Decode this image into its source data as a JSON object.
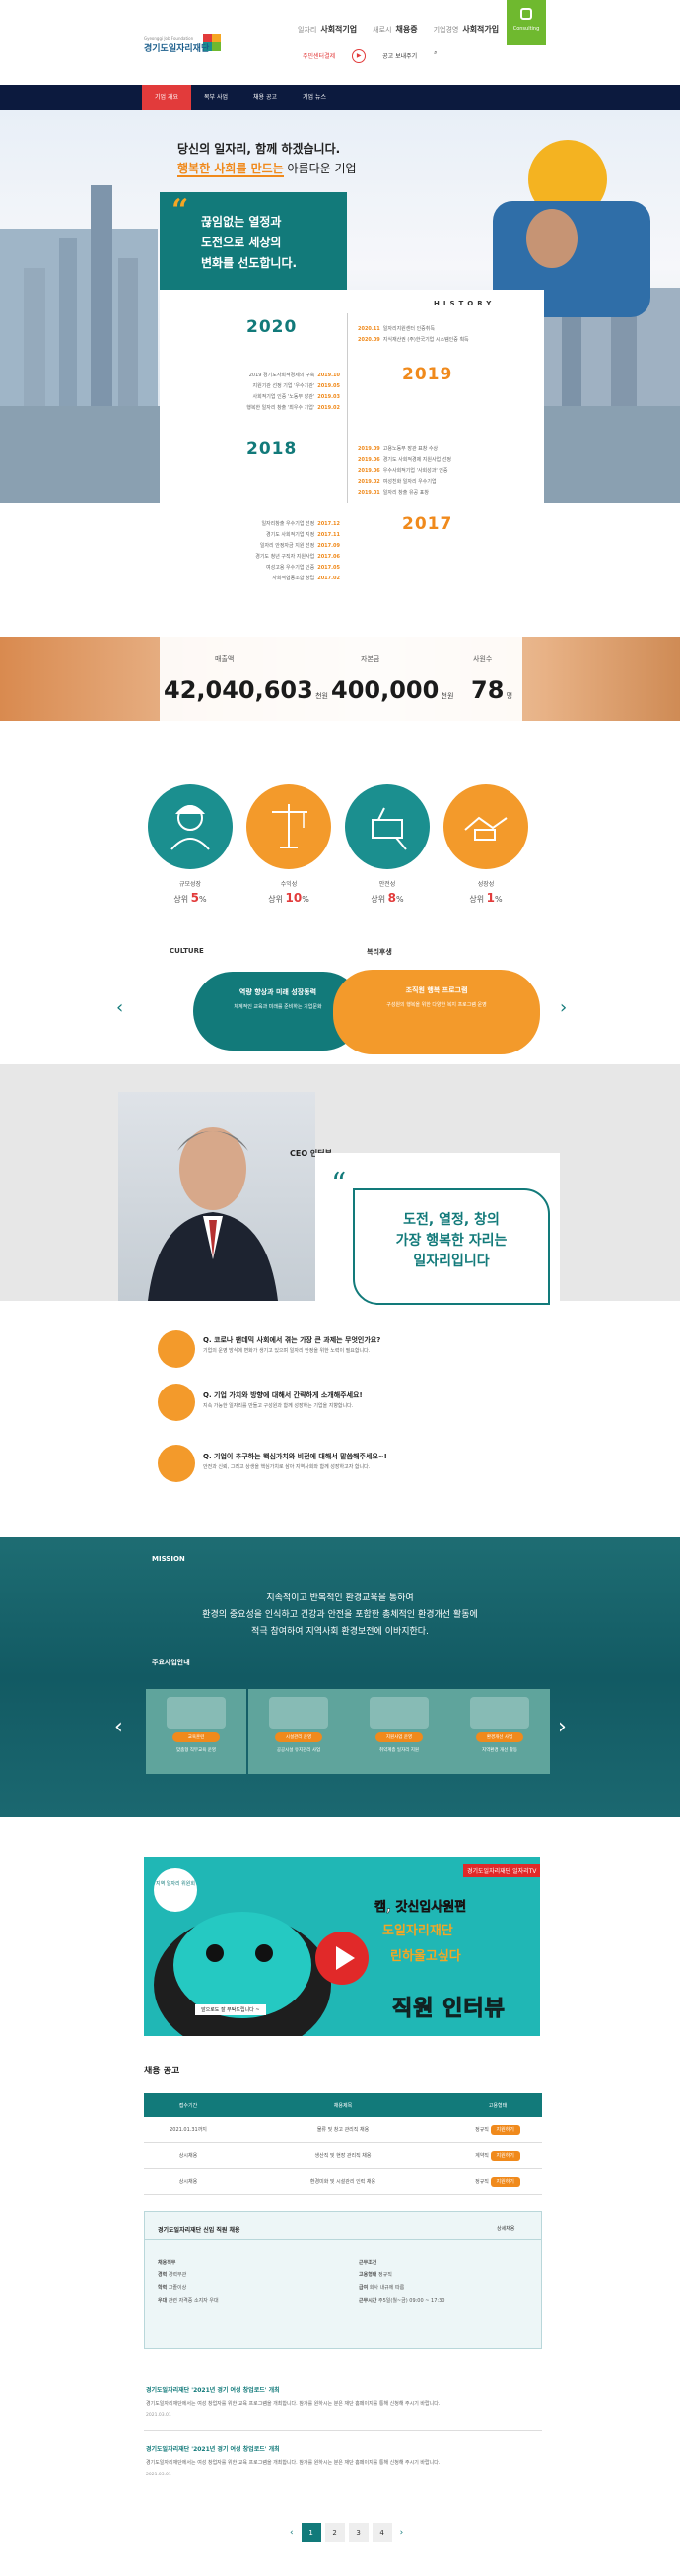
{
  "header": {
    "links": [
      {
        "pre": "일자리",
        "label": "사회적기업"
      },
      {
        "pre": "새로시",
        "label": "채용증"
      },
      {
        "pre": "기업경영",
        "label": "사회적가입"
      }
    ],
    "sub_links": [
      "주민센터결제",
      "공고 보내주기"
    ],
    "consult": "Consulting"
  },
  "nav": {
    "items": [
      "기업 개요",
      "복부 사업",
      "채용 공고",
      "기업 뉴스"
    ]
  },
  "hero": {
    "title1": "당신의 일자리, 함께 하겠습니다.",
    "title2_hl": "행복한 사회를 만드는",
    "title2_rest": " 아름다운 기업",
    "quote_mark": "“",
    "quote_lines": [
      "끊임없는 열정과",
      "도전으로 세상의",
      "변화를 선도합니다."
    ],
    "history_label": "HISTORY"
  },
  "history": {
    "y2020": "2020",
    "y2019": "2019",
    "y2018": "2018",
    "y2017": "2017",
    "right_2020": [
      {
        "d": "2020.11",
        "t": "일자리지원센터 인증취득"
      },
      {
        "d": "2020.09",
        "t": "지식재산권 (주)한국기업 시스템인증 획득"
      }
    ],
    "left_2020": [
      {
        "d": "2019.10",
        "t": "2019 경기도사회적경제의 구축"
      },
      {
        "d": "2019.05",
        "t": "지원기관 선정 기업 '우수기관'"
      },
      {
        "d": "2019.03",
        "t": "사회적기업 인증 '노동부 장관'"
      },
      {
        "d": "2019.02",
        "t": "행복한 일자리 창출 '최우수 기업'"
      }
    ],
    "right_2019": [
      {
        "d": "2019.09",
        "t": "고용노동부 장관 표창 수상"
      },
      {
        "d": "2019.06",
        "t": "경기도 사회적경제 지원사업 선정"
      },
      {
        "d": "2019.06",
        "t": "우수사회적기업 '사회성과' 인증"
      },
      {
        "d": "2019.02",
        "t": "여성친화 일자리 우수기업"
      },
      {
        "d": "2019.01",
        "t": "일자리 창출 유공 표창"
      }
    ],
    "left_2018": [
      {
        "d": "2017.12",
        "t": "일자리창출 우수기업 선정"
      },
      {
        "d": "2017.11",
        "t": "경기도 사회적기업 지정"
      },
      {
        "d": "2017.09",
        "t": "일자리 안정자금 지원 선정"
      },
      {
        "d": "2017.06",
        "t": "경기도 청년 구직자 지원사업"
      },
      {
        "d": "2017.05",
        "t": "여성고용 우수기업 인증"
      },
      {
        "d": "2017.02",
        "t": "사회적협동조합 창립"
      }
    ]
  },
  "stats": [
    {
      "label": "매출액",
      "value": "42,040,603",
      "unit": "천원"
    },
    {
      "label": "자본금",
      "value": "400,000",
      "unit": "천원"
    },
    {
      "label": "사원수",
      "value": "78",
      "unit": "명"
    }
  ],
  "growth": [
    {
      "label": "규모성장",
      "pre": "상위",
      "val": "5",
      "unit": "%",
      "icon": "worker-icon"
    },
    {
      "label": "수익성",
      "pre": "상위",
      "val": "10",
      "unit": "%",
      "icon": "crane-icon"
    },
    {
      "label": "안전성",
      "pre": "상위",
      "val": "8",
      "unit": "%",
      "icon": "tools-icon"
    },
    {
      "label": "성장성",
      "pre": "상위",
      "val": "1",
      "unit": "%",
      "icon": "handshake-icon"
    }
  ],
  "culture": {
    "culture_label": "CULTURE",
    "welfare_label": "복리후생",
    "card1_title": "역량 향상과 미래 성장동력",
    "card1_text": "체계적인 교육과 미래를 준비하는 기업문화",
    "card2_title": "조직원 행복 프로그램",
    "card2_text": "구성원의 행복을 위한 다양한 복지 프로그램 운영"
  },
  "ceo": {
    "label": "CEO 인터뷰",
    "bubble": [
      "도전, 열정, 창의",
      "가장 행복한 자리는",
      "일자리입니다"
    ],
    "qa": [
      {
        "q": "Q. 코로나 팬데믹 사회에서 겪는 가장 큰 과제는 무엇인가요?",
        "a": "기업의 운영 방식에 변화가 생기고 있으며 일자리 안정을 위한 노력이 필요합니다."
      },
      {
        "q": "Q. 기업 가치와 방향에 대해서 간략하게 소개해주세요!",
        "a": "지속 가능한 일자리를 만들고 구성원과 함께 성장하는 기업을 지향합니다."
      },
      {
        "q": "Q. 기업이 추구하는 핵심가치와 비전에 대해서 말씀해주세요~!",
        "a": "안전과 신뢰, 그리고 상생을 핵심가치로 삼아 지역사회와 함께 성장하고자 합니다."
      }
    ]
  },
  "mission": {
    "label": "MISSION",
    "lines": [
      "지속적이고 반복적인 환경교육을 통하여",
      "환경의 중요성을 인식하고 건강과 안전을 포함한 총체적인 환경개선 활동에",
      "적극 참여하여 지역사회 환경보전에 이바지한다."
    ],
    "biz_label": "주요사업안내",
    "cards": [
      {
        "btn": "교육훈련",
        "cap": "맞춤형 직무교육 운영"
      },
      {
        "btn": "시설관리 운영",
        "cap": "공공시설 유지관리 사업"
      },
      {
        "btn": "지원사업 운영",
        "cap": "취약계층 일자리 지원"
      },
      {
        "btn": "환경개선 사업",
        "cap": "지역환경 개선 활동"
      }
    ]
  },
  "video": {
    "badge": "지역 일자리 위원회",
    "channel": "경기도일자리재단 일자리TV",
    "line1": "캠, 갓신입사원편",
    "line2": "도일자리재단",
    "line3": "린하울고싶다",
    "main": "직원 인터뷰",
    "sign": "앞으로도 잘 부탁드립니다 ~"
  },
  "recruit": {
    "title": "채용 공고",
    "headers": [
      "접수기간",
      "채용제목",
      "고용형태"
    ],
    "rows": [
      {
        "date": "2021.01.31까지",
        "title": "물류 및 창고 관리직 채용",
        "type": "정규직",
        "tag": "지원하기"
      },
      {
        "date": "상시채용",
        "title": "생산직 및 현장 관리직 채용",
        "type": "계약직",
        "tag": "지원하기"
      },
      {
        "date": "상시채용",
        "title": "환경미화 및 시설관리 인력 채용",
        "type": "정규직",
        "tag": "지원하기"
      }
    ],
    "job_title": "경기도일자리재단 신입 직원 채용",
    "job_more": "상세채용",
    "job_left": [
      {
        "k": "채용직무",
        "v": ""
      },
      {
        "k": "경력",
        "v": "경력무관"
      },
      {
        "k": "학력",
        "v": "고졸이상"
      },
      {
        "k": "우대",
        "v": "관련 자격증 소지자 우대"
      }
    ],
    "job_right": [
      {
        "k": "근무조건",
        "v": ""
      },
      {
        "k": "고용형태",
        "v": "정규직"
      },
      {
        "k": "급여",
        "v": "회사 내규에 따름"
      },
      {
        "k": "근무시간",
        "v": "주5일(월~금) 09:00 ~ 17:30"
      }
    ]
  },
  "news": [
    {
      "title": "경기도일자리재단 '2021년 경기 여성 창업로드' 개최",
      "text": "경기도일자리재단에서는 여성 창업자를 위한 교육 프로그램을 개최합니다. 참가를 원하시는 분은 재단 홈페이지를 통해 신청해 주시기 바랍니다.",
      "date": "2021.03.01"
    },
    {
      "title": "경기도일자리재단 '2021년 경기 여성 창업로드' 개최",
      "text": "경기도일자리재단에서는 여성 창업자를 위한 교육 프로그램을 개최합니다. 참가를 원하시는 분은 재단 홈페이지를 통해 신청해 주시기 바랍니다.",
      "date": "2021.03.01"
    }
  ],
  "pager": {
    "prev": "‹",
    "pages": [
      "1",
      "2",
      "3",
      "4"
    ],
    "next": "›"
  }
}
